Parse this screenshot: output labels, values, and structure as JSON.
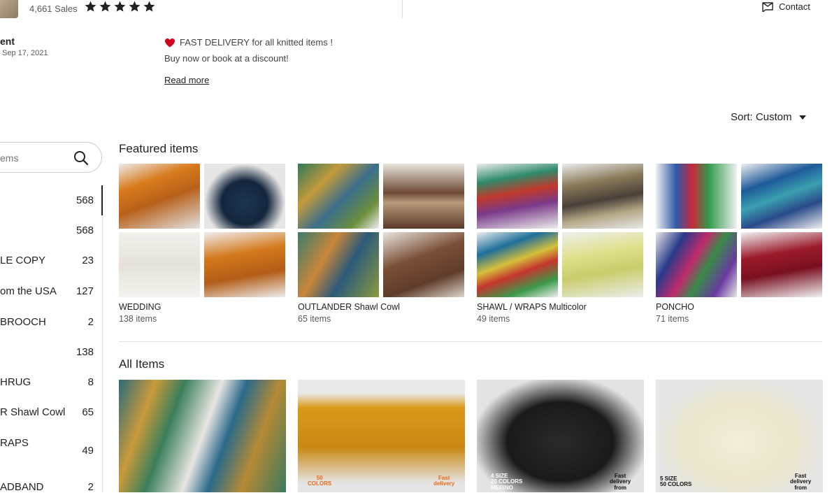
{
  "header": {
    "sales": "4,661 Sales",
    "rating_stars": 5,
    "contact_label": "Contact"
  },
  "owner": {
    "name_fragment": "ent",
    "date_fragment": "Sep 17, 2021"
  },
  "announcement": {
    "line1": "FAST DELIVERY for all knitted items !",
    "line2": "Buy now or book at a discount!",
    "read_more": "Read more"
  },
  "sort": {
    "label": "Sort: Custom"
  },
  "sidebar": {
    "search_placeholder": "ems",
    "categories": [
      {
        "label": "",
        "count": "568"
      },
      {
        "label": "",
        "count": "568"
      },
      {
        "label": "LE COPY",
        "count": "23"
      },
      {
        "label": "om the USA",
        "count": "127"
      },
      {
        "label": "BROOCH",
        "count": "2"
      },
      {
        "label": "",
        "count": "138"
      },
      {
        "label": "HRUG",
        "count": "8"
      },
      {
        "label": "R Shawl Cowl",
        "count": "65"
      },
      {
        "label": "RAPS",
        "count": "49"
      },
      {
        "label": "ADBAND",
        "count": "2"
      }
    ]
  },
  "featured": {
    "title": "Featured items",
    "collections": [
      {
        "name": "WEDDING",
        "count": "138 items"
      },
      {
        "name": "OUTLANDER Shawl Cowl",
        "count": "65 items"
      },
      {
        "name": "SHAWL / WRAPS Multicolor",
        "count": "49 items"
      },
      {
        "name": "PONCHO",
        "count": "71 items"
      }
    ]
  },
  "all_items": {
    "title": "All Items",
    "overlays": {
      "item2_left": "50\nCOLORS",
      "item2_right": "Fast\ndelivery",
      "item3_left": "4 SIZE\n20 COLORS\nMERINO",
      "item3_right": "Fast\ndelivery\nfrom",
      "item4_left": "5 SIZE\n50 COLORS",
      "item4_right": "Fast\ndelivery\nfrom"
    }
  },
  "colors": {
    "accent_text": "#222222",
    "muted_text": "#595959",
    "heart": "#d0021b",
    "overlay_orange": "#f06a1d"
  }
}
